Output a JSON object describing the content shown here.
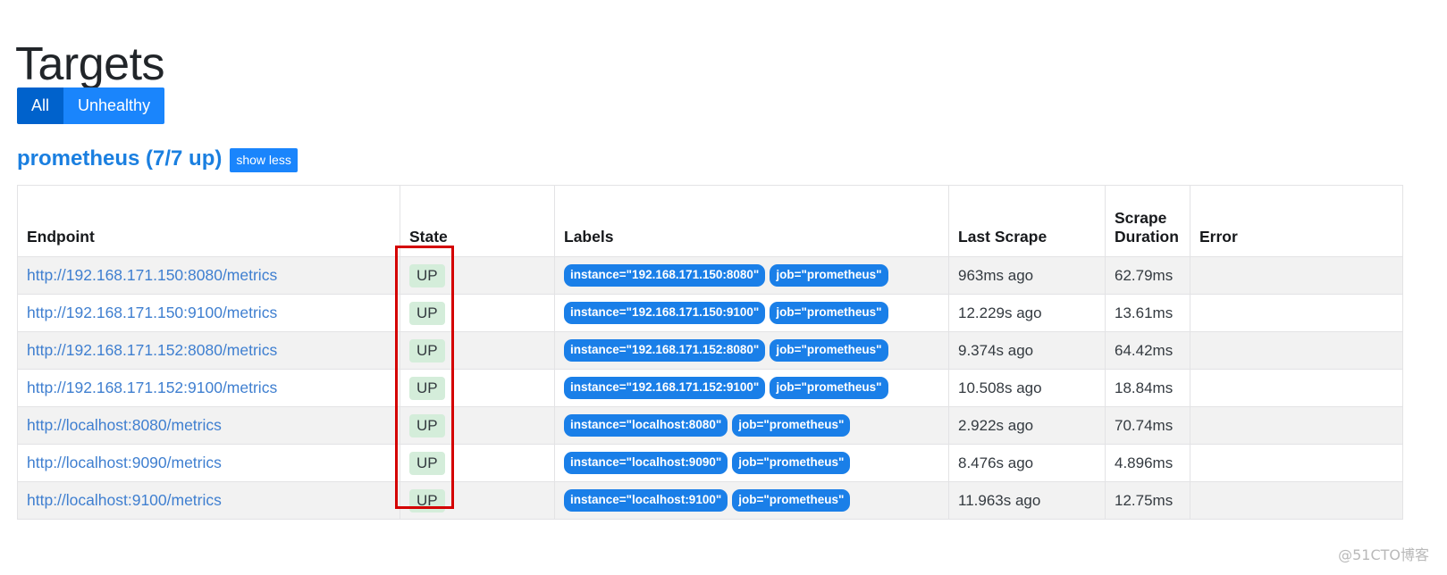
{
  "page": {
    "title": "Targets"
  },
  "filters": {
    "items": [
      {
        "label": "All",
        "active": true
      },
      {
        "label": "Unhealthy",
        "active": false
      }
    ]
  },
  "job_section": {
    "title": "prometheus (7/7 up)",
    "toggle_label": "show less"
  },
  "table": {
    "columns": [
      "Endpoint",
      "State",
      "Labels",
      "Last Scrape",
      "Scrape Duration",
      "Error"
    ],
    "rows": [
      {
        "endpoint": "http://192.168.171.150:8080/metrics",
        "state": "UP",
        "labels": [
          "instance=\"192.168.171.150:8080\"",
          "job=\"prometheus\""
        ],
        "last_scrape": "963ms ago",
        "scrape_duration": "62.79ms",
        "error": ""
      },
      {
        "endpoint": "http://192.168.171.150:9100/metrics",
        "state": "UP",
        "labels": [
          "instance=\"192.168.171.150:9100\"",
          "job=\"prometheus\""
        ],
        "last_scrape": "12.229s ago",
        "scrape_duration": "13.61ms",
        "error": ""
      },
      {
        "endpoint": "http://192.168.171.152:8080/metrics",
        "state": "UP",
        "labels": [
          "instance=\"192.168.171.152:8080\"",
          "job=\"prometheus\""
        ],
        "last_scrape": "9.374s ago",
        "scrape_duration": "64.42ms",
        "error": ""
      },
      {
        "endpoint": "http://192.168.171.152:9100/metrics",
        "state": "UP",
        "labels": [
          "instance=\"192.168.171.152:9100\"",
          "job=\"prometheus\""
        ],
        "last_scrape": "10.508s ago",
        "scrape_duration": "18.84ms",
        "error": ""
      },
      {
        "endpoint": "http://localhost:8080/metrics",
        "state": "UP",
        "labels": [
          "instance=\"localhost:8080\"",
          "job=\"prometheus\""
        ],
        "last_scrape": "2.922s ago",
        "scrape_duration": "70.74ms",
        "error": ""
      },
      {
        "endpoint": "http://localhost:9090/metrics",
        "state": "UP",
        "labels": [
          "instance=\"localhost:9090\"",
          "job=\"prometheus\""
        ],
        "last_scrape": "8.476s ago",
        "scrape_duration": "4.896ms",
        "error": ""
      },
      {
        "endpoint": "http://localhost:9100/metrics",
        "state": "UP",
        "labels": [
          "instance=\"localhost:9100\"",
          "job=\"prometheus\""
        ],
        "last_scrape": "11.963s ago",
        "scrape_duration": "12.75ms",
        "error": ""
      }
    ]
  },
  "annotation": {
    "shape": "rectangle",
    "color": "#d40000",
    "target_column": "State"
  },
  "watermark": {
    "text": "@51CTO博客"
  },
  "colors": {
    "primary_blue": "#1a85fc",
    "active_blue": "#0062cc",
    "link_blue": "#3f7fd0",
    "heading_blue": "#1a7fe0",
    "badge_blue": "#1a7fe8",
    "state_up_bg": "#d4edda",
    "row_stripe": "#f2f2f2",
    "border": "#e3e3e5",
    "annotation_red": "#d40000"
  }
}
